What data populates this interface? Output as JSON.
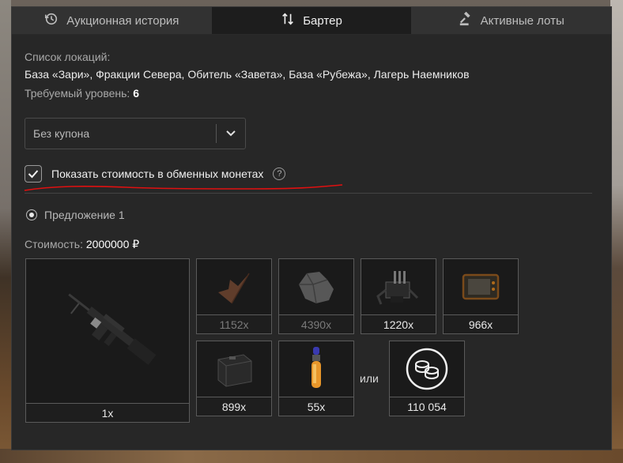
{
  "tabs": [
    {
      "label": "Аукционная история",
      "icon": "history-icon"
    },
    {
      "label": "Бартер",
      "icon": "swap-icon"
    },
    {
      "label": "Активные лоты",
      "icon": "gavel-icon"
    }
  ],
  "active_tab": 1,
  "locations_label": "Список локаций:",
  "locations_value": "База «Зари», Фракции Севера, Обитель «Завета», База «Рубежа», Лагерь Наемников",
  "level_label": "Требуемый уровень:",
  "level_value": "6",
  "coupon_select": {
    "value": "Без купона"
  },
  "exchange_checkbox": {
    "label": "Показать стоимость в обменных монетах",
    "checked": true
  },
  "offer": {
    "label": "Предложение 1",
    "selected": true
  },
  "cost_label": "Стоимость:",
  "cost_value": "2000000 ₽",
  "main_item": {
    "qty": "1x",
    "icon": "machine-gun-icon"
  },
  "items": [
    {
      "qty": "1152x",
      "icon": "feather-material-icon",
      "dim": true
    },
    {
      "qty": "4390x",
      "icon": "rock-material-icon",
      "dim": true
    },
    {
      "qty": "1220x",
      "icon": "device-icon",
      "dim": false
    },
    {
      "qty": "966x",
      "icon": "tablet-icon",
      "dim": false
    },
    {
      "qty": "899x",
      "icon": "battery-icon",
      "dim": false
    },
    {
      "qty": "55x",
      "icon": "injector-icon",
      "dim": false
    }
  ],
  "or_label": "или",
  "coins": {
    "qty": "110 054",
    "icon": "coins-icon"
  },
  "colors": {
    "panel": "#272727",
    "accent_red": "#e01010"
  }
}
